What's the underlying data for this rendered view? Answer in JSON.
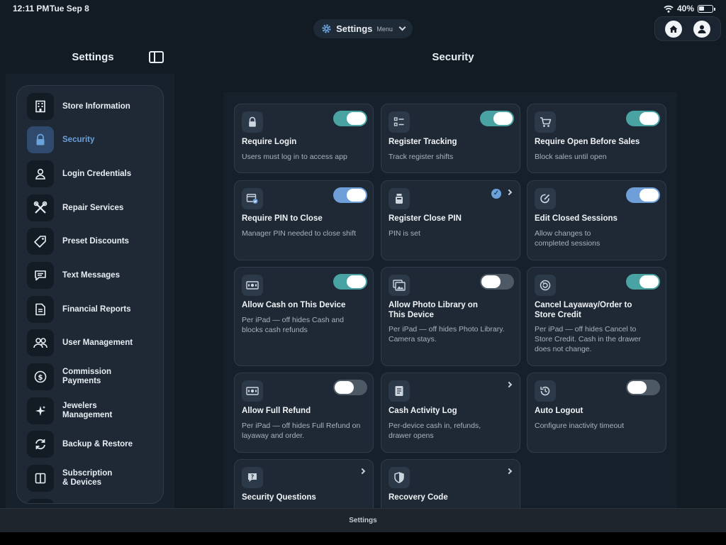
{
  "status_bar": {
    "time": "12:11 PM",
    "date": "Tue Sep 8",
    "battery": "40%"
  },
  "menu": {
    "title": "Settings",
    "subtitle": "Menu"
  },
  "sidebar": {
    "title": "Settings",
    "items": [
      {
        "label": "Store Information",
        "icon": "building-icon",
        "active": false
      },
      {
        "label": "Security",
        "icon": "lock-icon",
        "active": true
      },
      {
        "label": "Login Credentials",
        "icon": "person-icon",
        "active": false
      },
      {
        "label": "Repair Services",
        "icon": "tools-icon",
        "active": false
      },
      {
        "label": "Preset Discounts",
        "icon": "tag-icon",
        "active": false
      },
      {
        "label": "Text Messages",
        "icon": "message-icon",
        "active": false
      },
      {
        "label": "Financial Reports",
        "icon": "document-icon",
        "active": false
      },
      {
        "label": "User Management",
        "icon": "users-icon",
        "active": false
      },
      {
        "label": "Commission\nPayments",
        "icon": "dollar-icon",
        "active": false
      },
      {
        "label": "Jewelers\nManagement",
        "icon": "sparkle-icon",
        "active": false
      },
      {
        "label": "Backup & Restore",
        "icon": "sync-icon",
        "active": false
      },
      {
        "label": "Subscription\n& Devices",
        "icon": "device-icon",
        "active": false
      }
    ]
  },
  "main": {
    "title": "Security",
    "cards": [
      {
        "title": "Require Login",
        "desc": "Users must log in to access app",
        "icon": "lock-icon",
        "control": "toggle",
        "state": "on",
        "color": "#4aa3a3"
      },
      {
        "title": "Register Tracking",
        "desc": "Track register shifts",
        "icon": "checklist-icon",
        "control": "toggle",
        "state": "on",
        "color": "#4aa3a3"
      },
      {
        "title": "Require Open Before Sales",
        "desc": "Block sales until open",
        "icon": "cart-icon",
        "control": "toggle",
        "state": "on",
        "color": "#4aa3a3"
      },
      {
        "title": "Require PIN to Close",
        "desc": "Manager PIN needed to close shift",
        "icon": "pin-icon",
        "control": "toggle",
        "state": "on",
        "color": "#6f9fd8"
      },
      {
        "title": "Register Close PIN",
        "desc": "PIN is set",
        "icon": "register-icon",
        "control": "check-chevron",
        "state": "set",
        "color": "#6aa1da"
      },
      {
        "title": "Edit Closed Sessions",
        "desc": "Allow changes to\ncompleted sessions",
        "icon": "edit-icon",
        "control": "toggle",
        "state": "on",
        "color": "#6f9fd8"
      },
      {
        "title": "Allow Cash on This Device",
        "desc": "Per iPad — off hides Cash and\nblocks cash refunds",
        "icon": "cash-icon",
        "control": "toggle",
        "state": "on",
        "color": "#4aa3a3"
      },
      {
        "title": "Allow Photo Library on\nThis Device",
        "desc": "Per iPad — off hides Photo Library.\nCamera stays.",
        "icon": "photo-icon",
        "control": "toggle",
        "state": "off",
        "color": "#4e5966"
      },
      {
        "title": "Cancel Layaway/Order to\nStore Credit",
        "desc": "Per iPad — off hides Cancel to\nStore Credit. Cash in the drawer\ndoes not change.",
        "icon": "undo-icon",
        "control": "toggle",
        "state": "on",
        "color": "#4aa3a3"
      },
      {
        "title": "Allow Full Refund",
        "desc": "Per iPad — off hides Full Refund on\nlayaway and order.",
        "icon": "cash-icon",
        "control": "toggle",
        "state": "off",
        "color": "#4e5966"
      },
      {
        "title": "Cash Activity Log",
        "desc": "Per-device cash in, refunds,\ndrawer opens",
        "icon": "log-icon",
        "control": "chevron",
        "state": "",
        "color": ""
      },
      {
        "title": "Auto Logout",
        "desc": "Configure inactivity timeout",
        "icon": "history-icon",
        "control": "toggle",
        "state": "off",
        "color": "#4e5966"
      },
      {
        "title": "Security Questions",
        "desc": "",
        "icon": "question-icon",
        "control": "chevron",
        "state": "",
        "color": ""
      },
      {
        "title": "Recovery Code",
        "desc": "",
        "icon": "shield-icon",
        "control": "chevron",
        "state": "",
        "color": ""
      }
    ]
  },
  "bottom_bar": {
    "label": "Settings"
  }
}
